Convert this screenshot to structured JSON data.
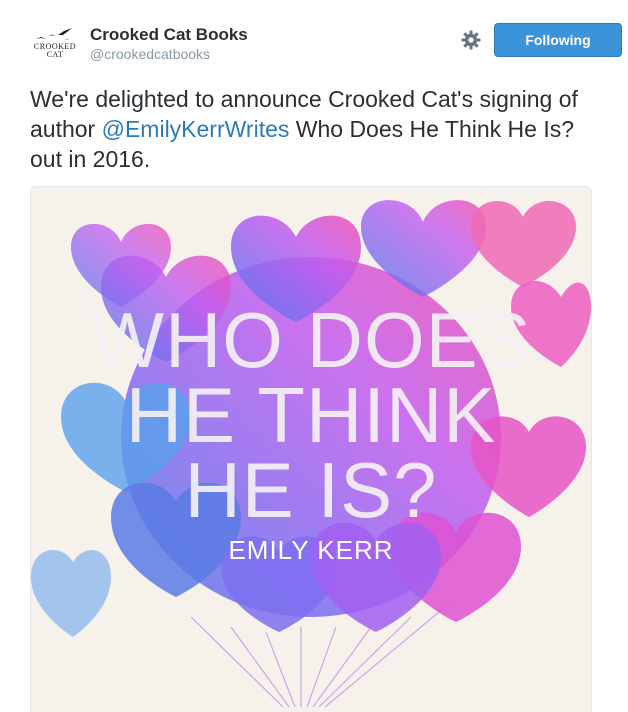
{
  "account": {
    "display_name": "Crooked Cat Books",
    "handle": "@crookedcatbooks",
    "logo_text_line1": "CROOKED",
    "logo_text_line2": "CAT"
  },
  "actions": {
    "settings_icon": "gear-icon",
    "follow_label": "Following"
  },
  "tweet": {
    "text_before": "We're delighted to announce Crooked Cat's signing of author ",
    "mention": "@EmilyKerrWrites",
    "text_after": " Who Does He Think He Is? out in 2016."
  },
  "cover": {
    "title_lines": [
      "WHO DOES",
      "HE THINK",
      "HE IS?"
    ],
    "author": "EMILY KERR"
  },
  "colors": {
    "follow_button": "#3b94d9",
    "mention_link": "#2b7bb9",
    "cover_background": "#f7f1ec"
  }
}
